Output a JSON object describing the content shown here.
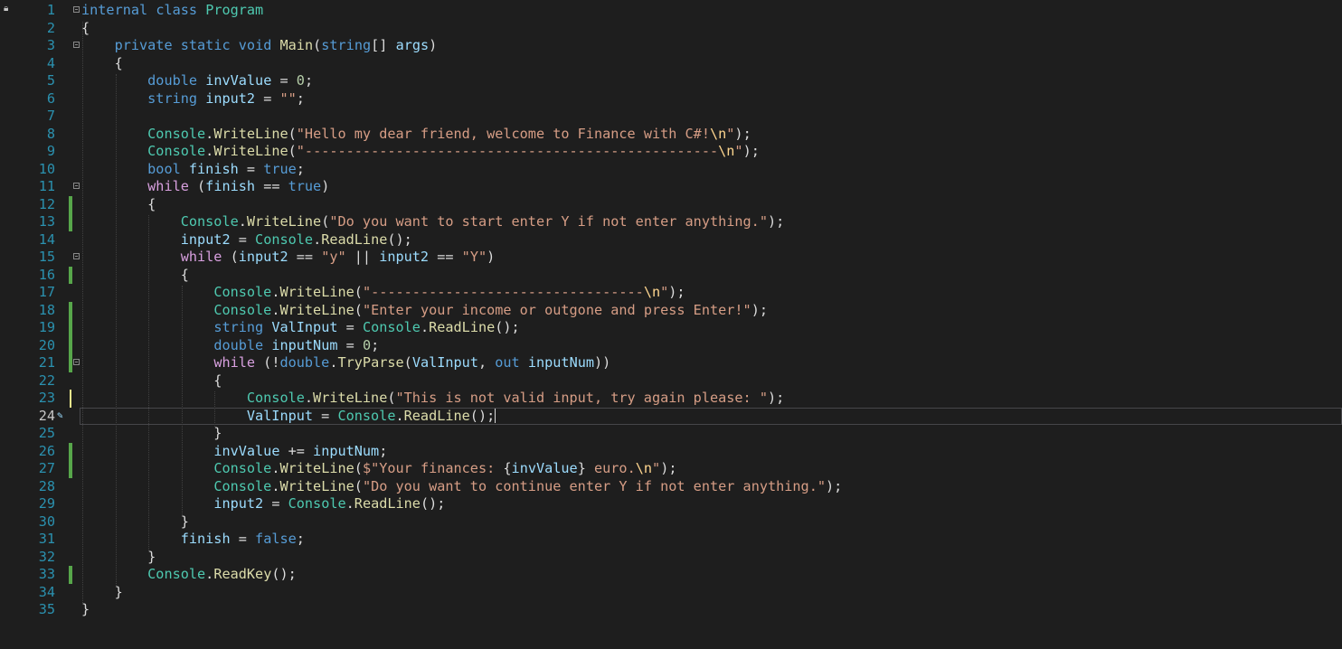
{
  "editor": {
    "current_line": 24,
    "lines": [
      {
        "n": "1",
        "fold": true,
        "bar": "",
        "tokens": [
          {
            "t": "internal",
            "c": "kw"
          },
          {
            "t": " ",
            "c": "pun"
          },
          {
            "t": "class",
            "c": "kw"
          },
          {
            "t": " ",
            "c": "pun"
          },
          {
            "t": "Program",
            "c": "typ"
          }
        ]
      },
      {
        "n": "2",
        "fold": false,
        "bar": "",
        "tokens": [
          {
            "t": "{",
            "c": "brace"
          }
        ]
      },
      {
        "n": "3",
        "fold": true,
        "bar": "",
        "tokens": [
          {
            "t": "    ",
            "c": "pun"
          },
          {
            "t": "private",
            "c": "kw"
          },
          {
            "t": " ",
            "c": "pun"
          },
          {
            "t": "static",
            "c": "kw"
          },
          {
            "t": " ",
            "c": "pun"
          },
          {
            "t": "void",
            "c": "kw"
          },
          {
            "t": " ",
            "c": "pun"
          },
          {
            "t": "Main",
            "c": "mth"
          },
          {
            "t": "(",
            "c": "pun"
          },
          {
            "t": "string",
            "c": "kw"
          },
          {
            "t": "[] ",
            "c": "pun"
          },
          {
            "t": "args",
            "c": "var"
          },
          {
            "t": ")",
            "c": "pun"
          }
        ]
      },
      {
        "n": "4",
        "fold": false,
        "bar": "",
        "tokens": [
          {
            "t": "    {",
            "c": "brace"
          }
        ]
      },
      {
        "n": "5",
        "fold": false,
        "bar": "",
        "tokens": [
          {
            "t": "        ",
            "c": "pun"
          },
          {
            "t": "double",
            "c": "kw"
          },
          {
            "t": " ",
            "c": "pun"
          },
          {
            "t": "invValue",
            "c": "var"
          },
          {
            "t": " = ",
            "c": "pun"
          },
          {
            "t": "0",
            "c": "num"
          },
          {
            "t": ";",
            "c": "pun"
          }
        ]
      },
      {
        "n": "6",
        "fold": false,
        "bar": "",
        "tokens": [
          {
            "t": "        ",
            "c": "pun"
          },
          {
            "t": "string",
            "c": "kw"
          },
          {
            "t": " ",
            "c": "pun"
          },
          {
            "t": "input2",
            "c": "var"
          },
          {
            "t": " = ",
            "c": "pun"
          },
          {
            "t": "\"\"",
            "c": "str"
          },
          {
            "t": ";",
            "c": "pun"
          }
        ]
      },
      {
        "n": "7",
        "fold": false,
        "bar": "",
        "tokens": []
      },
      {
        "n": "8",
        "fold": false,
        "bar": "",
        "tokens": [
          {
            "t": "        ",
            "c": "pun"
          },
          {
            "t": "Console",
            "c": "typ"
          },
          {
            "t": ".",
            "c": "pun"
          },
          {
            "t": "WriteLine",
            "c": "mth"
          },
          {
            "t": "(",
            "c": "pun"
          },
          {
            "t": "\"Hello my dear friend, welcome to Finance with C#!",
            "c": "str"
          },
          {
            "t": "\\n",
            "c": "esc"
          },
          {
            "t": "\"",
            "c": "str"
          },
          {
            "t": ");",
            "c": "pun"
          }
        ]
      },
      {
        "n": "9",
        "fold": false,
        "bar": "",
        "tokens": [
          {
            "t": "        ",
            "c": "pun"
          },
          {
            "t": "Console",
            "c": "typ"
          },
          {
            "t": ".",
            "c": "pun"
          },
          {
            "t": "WriteLine",
            "c": "mth"
          },
          {
            "t": "(",
            "c": "pun"
          },
          {
            "t": "\"--------------------------------------------------",
            "c": "str"
          },
          {
            "t": "\\n",
            "c": "esc"
          },
          {
            "t": "\"",
            "c": "str"
          },
          {
            "t": ");",
            "c": "pun"
          }
        ]
      },
      {
        "n": "10",
        "fold": false,
        "bar": "",
        "tokens": [
          {
            "t": "        ",
            "c": "pun"
          },
          {
            "t": "bool",
            "c": "kw"
          },
          {
            "t": " ",
            "c": "pun"
          },
          {
            "t": "finish",
            "c": "var"
          },
          {
            "t": " = ",
            "c": "pun"
          },
          {
            "t": "true",
            "c": "kw"
          },
          {
            "t": ";",
            "c": "pun"
          }
        ]
      },
      {
        "n": "11",
        "fold": true,
        "bar": "",
        "tokens": [
          {
            "t": "        ",
            "c": "pun"
          },
          {
            "t": "while",
            "c": "ctl"
          },
          {
            "t": " (",
            "c": "pun"
          },
          {
            "t": "finish",
            "c": "var"
          },
          {
            "t": " == ",
            "c": "pun"
          },
          {
            "t": "true",
            "c": "kw"
          },
          {
            "t": ")",
            "c": "pun"
          }
        ]
      },
      {
        "n": "12",
        "fold": false,
        "bar": "saved",
        "tokens": [
          {
            "t": "        {",
            "c": "brace"
          }
        ]
      },
      {
        "n": "13",
        "fold": false,
        "bar": "saved",
        "tokens": [
          {
            "t": "            ",
            "c": "pun"
          },
          {
            "t": "Console",
            "c": "typ"
          },
          {
            "t": ".",
            "c": "pun"
          },
          {
            "t": "WriteLine",
            "c": "mth"
          },
          {
            "t": "(",
            "c": "pun"
          },
          {
            "t": "\"Do you want to start enter Y if not enter anything.\"",
            "c": "str"
          },
          {
            "t": ");",
            "c": "pun"
          }
        ]
      },
      {
        "n": "14",
        "fold": false,
        "bar": "",
        "tokens": [
          {
            "t": "            ",
            "c": "pun"
          },
          {
            "t": "input2",
            "c": "var"
          },
          {
            "t": " = ",
            "c": "pun"
          },
          {
            "t": "Console",
            "c": "typ"
          },
          {
            "t": ".",
            "c": "pun"
          },
          {
            "t": "ReadLine",
            "c": "mth"
          },
          {
            "t": "();",
            "c": "pun"
          }
        ]
      },
      {
        "n": "15",
        "fold": true,
        "bar": "",
        "tokens": [
          {
            "t": "            ",
            "c": "pun"
          },
          {
            "t": "while",
            "c": "ctl"
          },
          {
            "t": " (",
            "c": "pun"
          },
          {
            "t": "input2",
            "c": "var"
          },
          {
            "t": " == ",
            "c": "pun"
          },
          {
            "t": "\"y\"",
            "c": "str"
          },
          {
            "t": " || ",
            "c": "pun"
          },
          {
            "t": "input2",
            "c": "var"
          },
          {
            "t": " == ",
            "c": "pun"
          },
          {
            "t": "\"Y\"",
            "c": "str"
          },
          {
            "t": ")",
            "c": "pun"
          }
        ]
      },
      {
        "n": "16",
        "fold": false,
        "bar": "saved",
        "tokens": [
          {
            "t": "            {",
            "c": "brace"
          }
        ]
      },
      {
        "n": "17",
        "fold": false,
        "bar": "",
        "tokens": [
          {
            "t": "                ",
            "c": "pun"
          },
          {
            "t": "Console",
            "c": "typ"
          },
          {
            "t": ".",
            "c": "pun"
          },
          {
            "t": "WriteLine",
            "c": "mth"
          },
          {
            "t": "(",
            "c": "pun"
          },
          {
            "t": "\"---------------------------------",
            "c": "str"
          },
          {
            "t": "\\n",
            "c": "esc"
          },
          {
            "t": "\"",
            "c": "str"
          },
          {
            "t": ");",
            "c": "pun"
          }
        ]
      },
      {
        "n": "18",
        "fold": false,
        "bar": "saved",
        "tokens": [
          {
            "t": "                ",
            "c": "pun"
          },
          {
            "t": "Console",
            "c": "typ"
          },
          {
            "t": ".",
            "c": "pun"
          },
          {
            "t": "WriteLine",
            "c": "mth"
          },
          {
            "t": "(",
            "c": "pun"
          },
          {
            "t": "\"Enter your income or outgone and press Enter!\"",
            "c": "str"
          },
          {
            "t": ");",
            "c": "pun"
          }
        ]
      },
      {
        "n": "19",
        "fold": false,
        "bar": "saved",
        "tokens": [
          {
            "t": "                ",
            "c": "pun"
          },
          {
            "t": "string",
            "c": "kw"
          },
          {
            "t": " ",
            "c": "pun"
          },
          {
            "t": "ValInput",
            "c": "var"
          },
          {
            "t": " = ",
            "c": "pun"
          },
          {
            "t": "Console",
            "c": "typ"
          },
          {
            "t": ".",
            "c": "pun"
          },
          {
            "t": "ReadLine",
            "c": "mth"
          },
          {
            "t": "();",
            "c": "pun"
          }
        ]
      },
      {
        "n": "20",
        "fold": false,
        "bar": "saved",
        "tokens": [
          {
            "t": "                ",
            "c": "pun"
          },
          {
            "t": "double",
            "c": "kw"
          },
          {
            "t": " ",
            "c": "pun"
          },
          {
            "t": "inputNum",
            "c": "var"
          },
          {
            "t": " = ",
            "c": "pun"
          },
          {
            "t": "0",
            "c": "num"
          },
          {
            "t": ";",
            "c": "pun"
          }
        ]
      },
      {
        "n": "21",
        "fold": true,
        "bar": "saved",
        "tokens": [
          {
            "t": "                ",
            "c": "pun"
          },
          {
            "t": "while",
            "c": "ctl"
          },
          {
            "t": " (!",
            "c": "pun"
          },
          {
            "t": "double",
            "c": "kw"
          },
          {
            "t": ".",
            "c": "pun"
          },
          {
            "t": "TryParse",
            "c": "mth"
          },
          {
            "t": "(",
            "c": "pun"
          },
          {
            "t": "ValInput",
            "c": "var"
          },
          {
            "t": ", ",
            "c": "pun"
          },
          {
            "t": "out",
            "c": "kw"
          },
          {
            "t": " ",
            "c": "pun"
          },
          {
            "t": "inputNum",
            "c": "var"
          },
          {
            "t": "))",
            "c": "pun"
          }
        ]
      },
      {
        "n": "22",
        "fold": false,
        "bar": "",
        "tokens": [
          {
            "t": "                {",
            "c": "brace"
          }
        ]
      },
      {
        "n": "23",
        "fold": false,
        "bar": "unsaved",
        "tokens": [
          {
            "t": "                    ",
            "c": "pun"
          },
          {
            "t": "Console",
            "c": "typ"
          },
          {
            "t": ".",
            "c": "pun"
          },
          {
            "t": "WriteLine",
            "c": "mth"
          },
          {
            "t": "(",
            "c": "pun"
          },
          {
            "t": "\"This is not valid input, try again please: \"",
            "c": "str"
          },
          {
            "t": ");",
            "c": "pun"
          }
        ]
      },
      {
        "n": "24",
        "fold": false,
        "bar": "",
        "tokens": [
          {
            "t": "                    ",
            "c": "pun"
          },
          {
            "t": "ValInput",
            "c": "var"
          },
          {
            "t": " = ",
            "c": "pun"
          },
          {
            "t": "Console",
            "c": "typ"
          },
          {
            "t": ".",
            "c": "pun"
          },
          {
            "t": "ReadLine",
            "c": "mth"
          },
          {
            "t": "();",
            "c": "pun"
          }
        ]
      },
      {
        "n": "25",
        "fold": false,
        "bar": "",
        "tokens": [
          {
            "t": "                }",
            "c": "brace"
          }
        ]
      },
      {
        "n": "26",
        "fold": false,
        "bar": "saved",
        "tokens": [
          {
            "t": "                ",
            "c": "pun"
          },
          {
            "t": "invValue",
            "c": "var"
          },
          {
            "t": " += ",
            "c": "pun"
          },
          {
            "t": "inputNum",
            "c": "var"
          },
          {
            "t": ";",
            "c": "pun"
          }
        ]
      },
      {
        "n": "27",
        "fold": false,
        "bar": "saved",
        "tokens": [
          {
            "t": "                ",
            "c": "pun"
          },
          {
            "t": "Console",
            "c": "typ"
          },
          {
            "t": ".",
            "c": "pun"
          },
          {
            "t": "WriteLine",
            "c": "mth"
          },
          {
            "t": "(",
            "c": "pun"
          },
          {
            "t": "$\"Your finances: ",
            "c": "str"
          },
          {
            "t": "{",
            "c": "pun"
          },
          {
            "t": "invValue",
            "c": "var"
          },
          {
            "t": "}",
            "c": "pun"
          },
          {
            "t": " euro.",
            "c": "str"
          },
          {
            "t": "\\n",
            "c": "esc"
          },
          {
            "t": "\"",
            "c": "str"
          },
          {
            "t": ");",
            "c": "pun"
          }
        ]
      },
      {
        "n": "28",
        "fold": false,
        "bar": "",
        "tokens": [
          {
            "t": "                ",
            "c": "pun"
          },
          {
            "t": "Console",
            "c": "typ"
          },
          {
            "t": ".",
            "c": "pun"
          },
          {
            "t": "WriteLine",
            "c": "mth"
          },
          {
            "t": "(",
            "c": "pun"
          },
          {
            "t": "\"Do you want to continue enter Y if not enter anything.\"",
            "c": "str"
          },
          {
            "t": ");",
            "c": "pun"
          }
        ]
      },
      {
        "n": "29",
        "fold": false,
        "bar": "",
        "tokens": [
          {
            "t": "                ",
            "c": "pun"
          },
          {
            "t": "input2",
            "c": "var"
          },
          {
            "t": " = ",
            "c": "pun"
          },
          {
            "t": "Console",
            "c": "typ"
          },
          {
            "t": ".",
            "c": "pun"
          },
          {
            "t": "ReadLine",
            "c": "mth"
          },
          {
            "t": "();",
            "c": "pun"
          }
        ]
      },
      {
        "n": "30",
        "fold": false,
        "bar": "",
        "tokens": [
          {
            "t": "            }",
            "c": "brace"
          }
        ]
      },
      {
        "n": "31",
        "fold": false,
        "bar": "",
        "tokens": [
          {
            "t": "            ",
            "c": "pun"
          },
          {
            "t": "finish",
            "c": "var"
          },
          {
            "t": " = ",
            "c": "pun"
          },
          {
            "t": "false",
            "c": "kw"
          },
          {
            "t": ";",
            "c": "pun"
          }
        ]
      },
      {
        "n": "32",
        "fold": false,
        "bar": "",
        "tokens": [
          {
            "t": "        }",
            "c": "brace"
          }
        ]
      },
      {
        "n": "33",
        "fold": false,
        "bar": "saved",
        "tokens": [
          {
            "t": "        ",
            "c": "pun"
          },
          {
            "t": "Console",
            "c": "typ"
          },
          {
            "t": ".",
            "c": "pun"
          },
          {
            "t": "ReadKey",
            "c": "mth"
          },
          {
            "t": "();",
            "c": "pun"
          }
        ]
      },
      {
        "n": "34",
        "fold": false,
        "bar": "",
        "tokens": [
          {
            "t": "    }",
            "c": "brace"
          }
        ]
      },
      {
        "n": "35",
        "fold": false,
        "bar": "",
        "tokens": [
          {
            "t": "}",
            "c": "brace"
          }
        ]
      }
    ]
  },
  "colors": {
    "background": "#1e1e1e",
    "line_number": "#2b91af",
    "saved_change": "#57a64a",
    "unsaved_change": "#efeb8c"
  }
}
